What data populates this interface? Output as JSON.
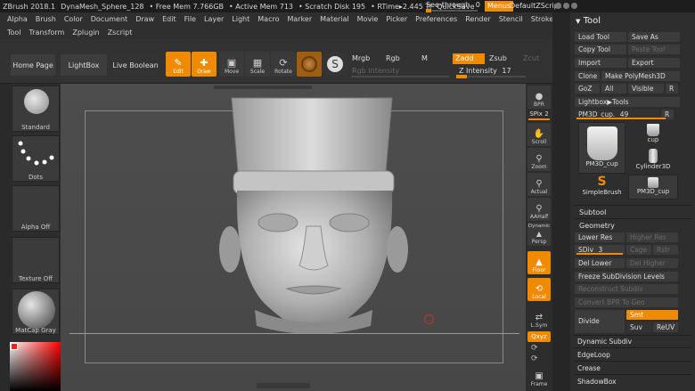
{
  "titlebar": {
    "segments": [
      "ZBrush 2018.1",
      "DynaMesh_Sphere_128",
      "• Free Mem 7.766GB",
      "• Active Mem 713",
      "• Scratch Disk 195",
      "• RTime▸2.445 Ti",
      "QuickSave"
    ],
    "see_through_label": "See-through",
    "see_through_value": "0",
    "see_through_level": 0,
    "menus_label": "Menus",
    "default_zscript": "DefaultZScript"
  },
  "menubar": {
    "row1": [
      "Alpha",
      "Brush",
      "Color",
      "Document",
      "Draw",
      "Edit",
      "File",
      "Layer",
      "Light",
      "Macro",
      "Marker",
      "Material",
      "Movie",
      "Picker",
      "Preferences",
      "Render",
      "Stencil",
      "Stroke",
      "Texture"
    ],
    "row2": [
      "Tool",
      "Transform",
      "Zplugin",
      "Zscript"
    ]
  },
  "toolbar": {
    "home_page": "Home Page",
    "lightbox": "LightBox",
    "live_boolean": "Live Boolean",
    "edit": "Edit",
    "draw": "Draw",
    "move": "Move",
    "scale": "Scale",
    "rotate": "Rotate",
    "mrgb": "Mrgb",
    "rgb": "Rgb",
    "m": "M",
    "zadd": "Zadd",
    "zsub": "Zsub",
    "zcut": "Zcut",
    "rgb_intensity": "Rgb Intensity",
    "z_intensity": "Z Intensity",
    "z_intensity_value": "17"
  },
  "left_panel": {
    "standard": "Standard",
    "dots": "Dots",
    "alpha_off": "Alpha Off",
    "texture_off": "Texture Off",
    "matcap_gray": "MatCap Gray"
  },
  "right_shelf": {
    "bpr": "BPR",
    "spix_label": "SPix",
    "spix_value": "2",
    "scroll": "Scroll",
    "zoom": "Zoom",
    "actual": "Actual",
    "aahalf": "AAHalf",
    "dynamic": "Dynamic",
    "persp": "Persp",
    "floor": "Floor",
    "local": "Local",
    "lsym": "L.Sym",
    "xyz": "Qxyz",
    "frame": "Frame"
  },
  "tool_panel": {
    "title": "Tool",
    "load_tool": "Load Tool",
    "save_as": "Save As",
    "copy_tool": "Copy Tool",
    "paste_tool": "Paste Tool",
    "import": "Import",
    "export": "Export",
    "clone": "Clone",
    "make_polymesh": "Make PolyMesh3D",
    "goz": "GoZ",
    "all": "All",
    "visible": "Visible",
    "r": "R",
    "lightbox_tools": "Lightbox▶Tools",
    "current_tool_name": "PM3D_cup.",
    "current_tool_value": "49",
    "thumb_pm3d_cup": "PM3D_cup",
    "thumb_cup": "cup",
    "thumb_cylinder": "Cylinder3D",
    "thumb_simplebrush": "SimpleBrush",
    "thumb_pm3d_cup2": "PM3D_cup",
    "subtool": "Subtool",
    "geometry": "Geometry",
    "lower_res": "Lower Res",
    "higher_res": "Higher Res",
    "sdiv_label": "SDiv",
    "sdiv_value": "3",
    "cage": "Cage",
    "rstr": "Rstr",
    "del_lower": "Del Lower",
    "del_higher": "Del Higher",
    "freeze_subdiv": "Freeze SubDivision Levels",
    "reconstruct_subdiv": "Reconstruct Subdiv",
    "convert_bpr": "Convert BPR To Geo",
    "divide": "Divide",
    "smt": "Smt",
    "suv": "Suv",
    "reuv": "ReUV",
    "dynamic_subdiv": "Dynamic Subdiv",
    "edgeloop": "EdgeLoop",
    "crease": "Crease",
    "shadowbox": "ShadowBox"
  },
  "colors": {
    "accent": "#f08a00",
    "panel": "#2e2e2e",
    "canvas": "#4b4b4b"
  }
}
